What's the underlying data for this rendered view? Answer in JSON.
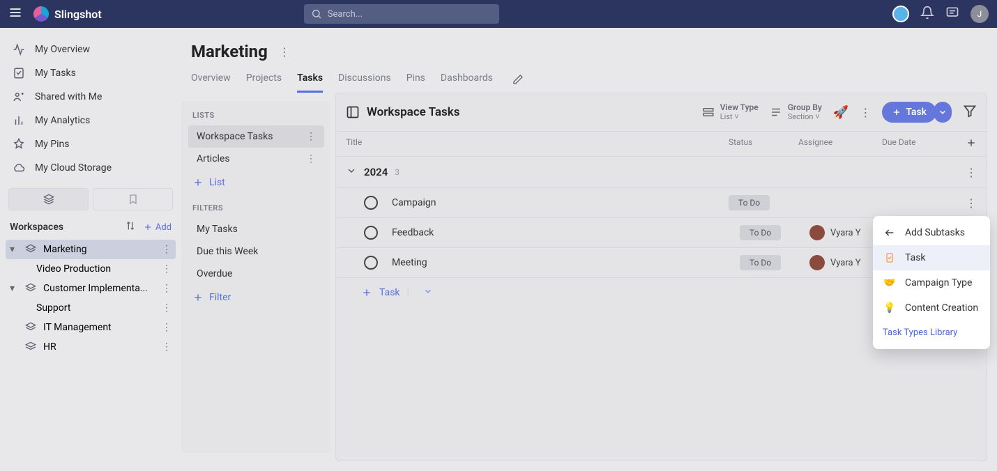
{
  "app": {
    "name": "Slingshot"
  },
  "search": {
    "placeholder": "Search..."
  },
  "top_user_initial": "J",
  "sidebar": {
    "nav": [
      {
        "label": "My Overview"
      },
      {
        "label": "My Tasks"
      },
      {
        "label": "Shared with Me"
      },
      {
        "label": "My Analytics"
      },
      {
        "label": "My Pins"
      },
      {
        "label": "My Cloud Storage"
      }
    ],
    "workspaces_label": "Workspaces",
    "add_label": "Add",
    "workspaces": [
      {
        "label": "Marketing",
        "children": [
          "Video Production"
        ]
      },
      {
        "label": "Customer Implementa...",
        "children": [
          "Support"
        ]
      },
      {
        "label": "IT Management"
      },
      {
        "label": "HR"
      }
    ]
  },
  "page": {
    "title": "Marketing",
    "tabs": [
      "Overview",
      "Projects",
      "Tasks",
      "Discussions",
      "Pins",
      "Dashboards"
    ],
    "active_tab": "Tasks"
  },
  "lists_panel": {
    "lists_label": "LISTS",
    "lists": [
      {
        "label": "Workspace Tasks",
        "selected": true
      },
      {
        "label": "Articles"
      }
    ],
    "add_list_label": "List",
    "filters_label": "FILTERS",
    "filters": [
      "My Tasks",
      "Due this Week",
      "Overdue"
    ],
    "add_filter_label": "Filter"
  },
  "tasks_view": {
    "title": "Workspace Tasks",
    "view_type": {
      "label": "View Type",
      "value": "List"
    },
    "group_by": {
      "label": "Group By",
      "value": "Section"
    },
    "task_btn_label": "Task",
    "columns": [
      "Title",
      "Status",
      "Assignee",
      "Due Date"
    ],
    "group": {
      "name": "2024",
      "count": "3"
    },
    "rows": [
      {
        "title": "Campaign",
        "status": "To Do",
        "assignee": ""
      },
      {
        "title": "Feedback",
        "status": "To Do",
        "assignee": "Vyara Y"
      },
      {
        "title": "Meeting",
        "status": "To Do",
        "assignee": "Vyara Y"
      }
    ],
    "add_task_label": "Task"
  },
  "context_menu": {
    "header": "Add Subtasks",
    "items": [
      {
        "label": "Task",
        "selected": true
      },
      {
        "label": "Campaign Type"
      },
      {
        "label": "Content Creation"
      }
    ],
    "link": "Task Types Library"
  }
}
